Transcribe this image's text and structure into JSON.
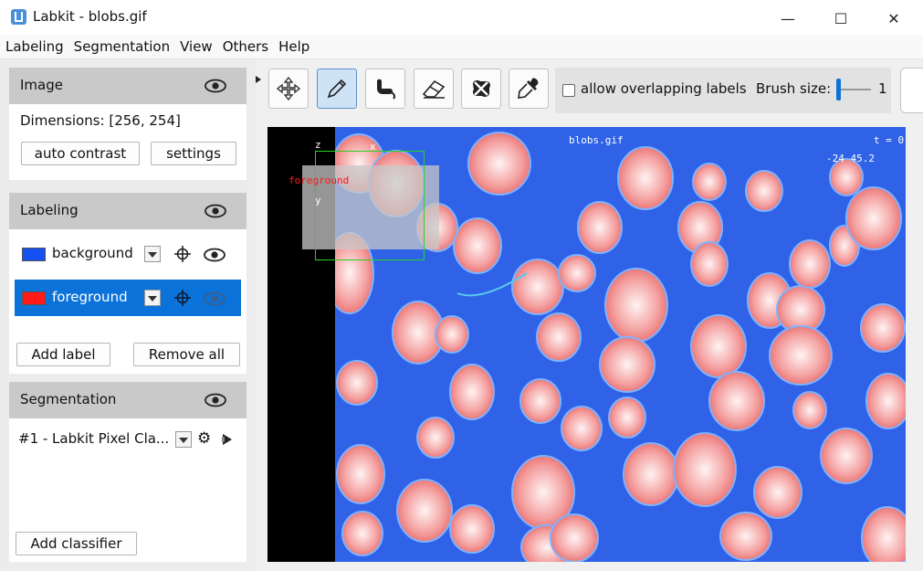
{
  "window": {
    "title": "Labkit - blobs.gif",
    "minimize": "—",
    "maximize": "☐",
    "close": "✕"
  },
  "menu": [
    "Labeling",
    "Segmentation",
    "View",
    "Others",
    "Help"
  ],
  "image_panel": {
    "title": "Image",
    "dimensions": "Dimensions: [256, 254]",
    "auto_contrast": "auto contrast",
    "settings": "settings"
  },
  "labeling_panel": {
    "title": "Labeling",
    "labels": [
      {
        "name": "background",
        "color": "#1550f0",
        "selected": false
      },
      {
        "name": "foreground",
        "color": "#ff1a1a",
        "selected": true
      }
    ],
    "add_label": "Add label",
    "remove_all": "Remove all"
  },
  "segmentation_panel": {
    "title": "Segmentation",
    "classifier": "#1 - Labkit Pixel Cla...",
    "add_classifier": "Add classifier"
  },
  "toolbar": {
    "tools": [
      "move-icon",
      "pencil-icon",
      "flood-fill-icon",
      "eraser-icon",
      "flood-erase-icon",
      "color-picker-icon"
    ],
    "active_tool": "pencil-icon",
    "allow_overlapping": "allow overlapping labels",
    "brush_size_label": "Brush size:",
    "brush_size_value": "1"
  },
  "viewer": {
    "filename": "blobs.gif",
    "time": "t = 0",
    "coords": "-24   45.2",
    "axis_z": "z",
    "axis_x": "x",
    "axis_y": "y",
    "overlay_label": "foreground",
    "colors": {
      "background_label": "#2f62e6",
      "foreground_blob": "#f08a8a"
    }
  }
}
